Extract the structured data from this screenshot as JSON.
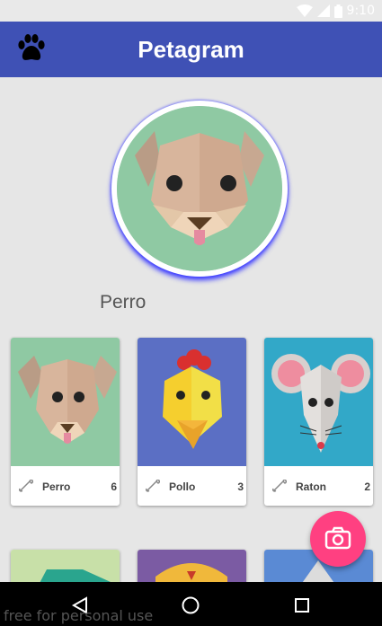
{
  "status_bar": {
    "time": "9:10",
    "icons": [
      "wifi-icon",
      "signal-icon",
      "battery-icon"
    ]
  },
  "toolbar": {
    "title": "Petagram",
    "icon": "paw-icon",
    "color": "#3f51b5"
  },
  "profile": {
    "name": "Perro"
  },
  "cards": [
    {
      "name": "Perro",
      "likes": "6"
    },
    {
      "name": "Pollo",
      "likes": "3"
    },
    {
      "name": "Raton",
      "likes": "2"
    }
  ],
  "fab": {
    "icon": "camera-icon",
    "color": "#ff4081"
  },
  "nav_bar": {
    "icons": [
      "back-icon",
      "home-icon",
      "recents-icon"
    ]
  },
  "watermark": "free for personal use"
}
